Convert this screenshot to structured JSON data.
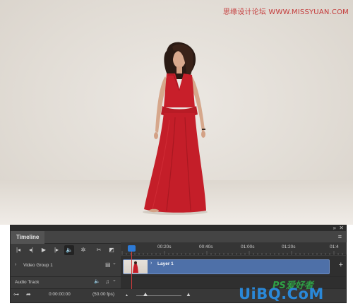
{
  "watermark_top": "思缘设计论坛 WWW.MISSYUAN.COM",
  "watermark_bottom": {
    "brand": "UiBQ.CoM",
    "mark": "PS爱好者"
  },
  "timeline": {
    "tab_label": "Timeline",
    "collapse_glyph": "»",
    "close_glyph": "✕",
    "menu_glyph": "≡",
    "controls": [
      {
        "name": "go-to-first-frame",
        "icon": "first-frame-icon",
        "glyph": "|◂"
      },
      {
        "name": "previous-frame",
        "icon": "previous-frame-icon",
        "glyph": "◂|"
      },
      {
        "name": "play",
        "icon": "play-icon",
        "glyph": "▶"
      },
      {
        "name": "next-frame",
        "icon": "next-frame-icon",
        "glyph": "|▸"
      },
      {
        "name": "mute-audio",
        "icon": "speaker-icon",
        "glyph": "🔈"
      },
      {
        "name": "settings",
        "icon": "gear-icon",
        "glyph": "✲"
      },
      {
        "name": "split-at-playhead",
        "icon": "scissors-icon",
        "glyph": "✂"
      },
      {
        "name": "transition",
        "icon": "transition-icon",
        "glyph": "◩"
      }
    ],
    "ruler_labels": [
      "00:20s",
      "00:40s",
      "01:00s",
      "01:20s",
      "01:4"
    ],
    "video_group": {
      "name": "Video Group 1",
      "chevron": "›",
      "film_icon": "film-strip-icon",
      "film_glyph": "▤",
      "dropdown_glyph": "⌄"
    },
    "clip": {
      "label": "Layer 1",
      "chevron": "›"
    },
    "add_glyph": "+",
    "audio_track": {
      "name": "Audio Track",
      "speaker_icon": "speaker-icon",
      "speaker_glyph": "🔈",
      "note_icon": "music-note-icon",
      "note_glyph": "♫",
      "dropdown_glyph": "⌄"
    },
    "footer": {
      "render_icon": "render-video-icon",
      "render_glyph": "⊶",
      "convert_icon": "convert-icon",
      "convert_glyph": "➦",
      "timecode": "0:00:00:00",
      "fps": "(50.00 fps)",
      "zoom_out_glyph": "▲",
      "zoom_in_glyph": "▲"
    }
  }
}
